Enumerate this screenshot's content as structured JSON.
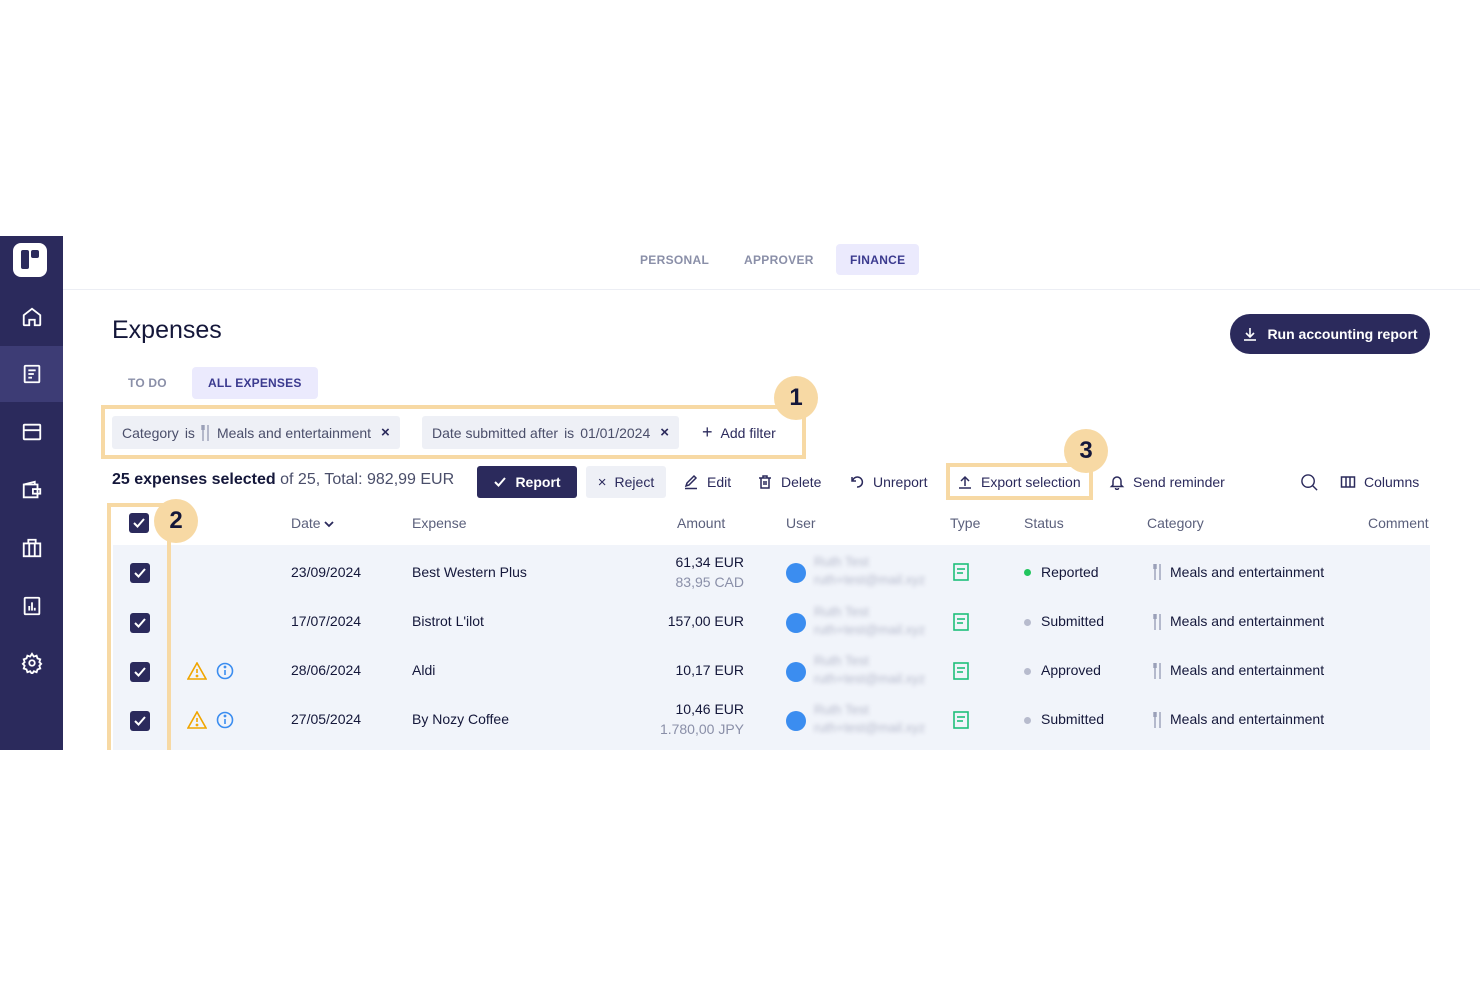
{
  "top_tabs": [
    {
      "label": "PERSONAL"
    },
    {
      "label": "APPROVER"
    },
    {
      "label": "FINANCE"
    }
  ],
  "page": {
    "title": "Expenses",
    "run_report_label": "Run accounting report"
  },
  "sub_tabs": [
    {
      "label": "TO DO"
    },
    {
      "label": "ALL EXPENSES"
    }
  ],
  "filters": {
    "category": {
      "field": "Category",
      "op": "is",
      "value": "Meals and entertainment"
    },
    "date": {
      "field": "Date submitted after",
      "op": "is",
      "value": "01/01/2024"
    },
    "add_label": "Add filter"
  },
  "selection": {
    "count_text": "25 expenses selected",
    "rest_text": "of 25, Total: 982,99 EUR"
  },
  "actions": {
    "report": "Report",
    "reject": "Reject",
    "edit": "Edit",
    "delete": "Delete",
    "unreport": "Unreport",
    "export": "Export selection",
    "reminder": "Send reminder",
    "columns": "Columns"
  },
  "table": {
    "headers": {
      "date": "Date",
      "expense": "Expense",
      "amount": "Amount",
      "user": "User",
      "type": "Type",
      "status": "Status",
      "category": "Category",
      "comment": "Comment"
    },
    "rows": [
      {
        "date": "23/09/2024",
        "expense": "Best Western Plus",
        "amount": "61,34 EUR",
        "amount_sub": "83,95 CAD",
        "user_name": "Ruth Test",
        "user_email": "ruth+test@mail.xyz",
        "status": "Reported",
        "category": "Meals and entertainment"
      },
      {
        "date": "17/07/2024",
        "expense": "Bistrot L'ilot",
        "amount": "157,00 EUR",
        "amount_sub": "",
        "user_name": "Ruth Test",
        "user_email": "ruth+test@mail.xyz",
        "status": "Submitted",
        "category": "Meals and entertainment"
      },
      {
        "date": "28/06/2024",
        "expense": "Aldi",
        "amount": "10,17 EUR",
        "amount_sub": "",
        "user_name": "Ruth Test",
        "user_email": "ruth+test@mail.xyz",
        "status": "Approved",
        "category": "Meals and entertainment"
      },
      {
        "date": "27/05/2024",
        "expense": "By Nozy Coffee",
        "amount": "10,46 EUR",
        "amount_sub": "1.780,00 JPY",
        "user_name": "Ruth Test",
        "user_email": "ruth+test@mail.xyz",
        "status": "Submitted",
        "category": "Meals and entertainment"
      }
    ]
  },
  "annotations": {
    "one": "1",
    "two": "2",
    "three": "3"
  },
  "colors": {
    "brand": "#2b2a5c",
    "highlight": "#f7d9a4",
    "status_reported": "#22c55e",
    "status_other": "#b7bbcd"
  }
}
